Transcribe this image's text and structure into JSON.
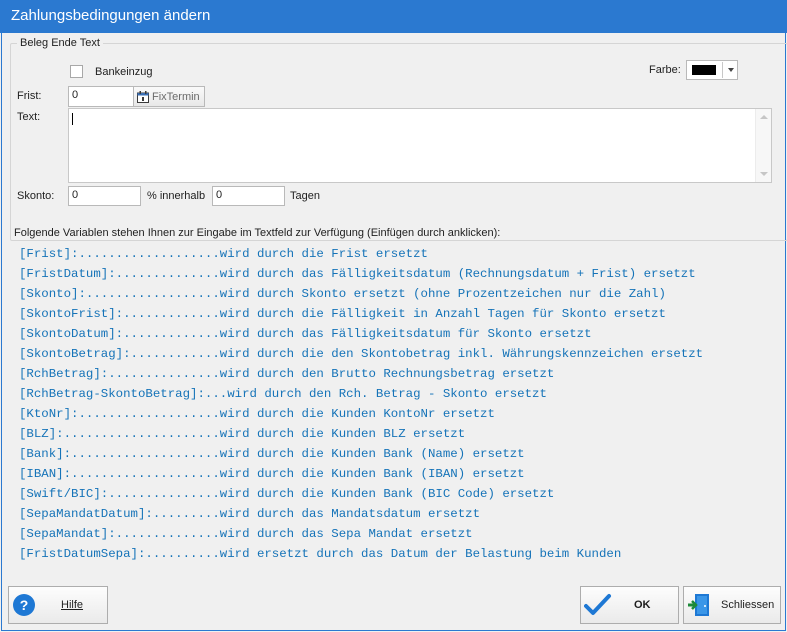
{
  "window": {
    "title": "Zahlungsbedingungen ändern"
  },
  "group": {
    "title": "Beleg Ende Text"
  },
  "bankeinzug": {
    "label": "Bankeinzug"
  },
  "farbe": {
    "label": "Farbe:",
    "value_color": "#000000"
  },
  "frist": {
    "label": "Frist:",
    "value": "0",
    "fixtermin_label": "FixTermin"
  },
  "text": {
    "label": "Text:",
    "value": ""
  },
  "skonto": {
    "label": "Skonto:",
    "value": "0",
    "innerhalb_label": "% innerhalb",
    "tage_value": "0",
    "tage_label": "Tagen"
  },
  "variables": {
    "heading": "Folgende Variablen stehen Ihnen zur Eingabe im Textfeld zur Verfügung (Einfügen durch anklicken):",
    "items": [
      "[Frist]:...................wird durch die Frist ersetzt",
      "[FristDatum]:..............wird durch das Fälligkeitsdatum (Rechnungsdatum + Frist) ersetzt",
      "[Skonto]:..................wird durch Skonto ersetzt (ohne Prozentzeichen nur die Zahl)",
      "[SkontoFrist]:.............wird durch die Fälligkeit in Anzahl Tagen für Skonto ersetzt",
      "[SkontoDatum]:.............wird durch das Fälligkeitsdatum für Skonto ersetzt",
      "[SkontoBetrag]:............wird durch die den Skontobetrag inkl. Währungskennzeichen ersetzt",
      "[RchBetrag]:...............wird durch den Brutto Rechnungsbetrag ersetzt",
      "[RchBetrag-SkontoBetrag]:...wird durch den Rch. Betrag - Skonto ersetzt",
      "[KtoNr]:...................wird durch die Kunden KontoNr ersetzt",
      "[BLZ]:.....................wird durch die Kunden BLZ ersetzt",
      "[Bank]:....................wird durch die Kunden Bank (Name) ersetzt",
      "[IBAN]:....................wird durch die Kunden Bank (IBAN) ersetzt",
      "[Swift/BIC]:...............wird durch die Kunden Bank (BIC Code) ersetzt",
      "[SepaMandatDatum]:.........wird durch das Mandatsdatum ersetzt",
      "[SepaMandat]:..............wird durch das Sepa Mandat ersetzt",
      "[FristDatumSepa]:..........wird ersetzt durch das Datum der Belastung beim Kunden"
    ]
  },
  "footer": {
    "help_label": "Hilfe",
    "ok_label": "OK",
    "close_label": "Schliessen"
  },
  "colors": {
    "titlebar": "#2b79d0",
    "variable_text": "#1573b8"
  }
}
